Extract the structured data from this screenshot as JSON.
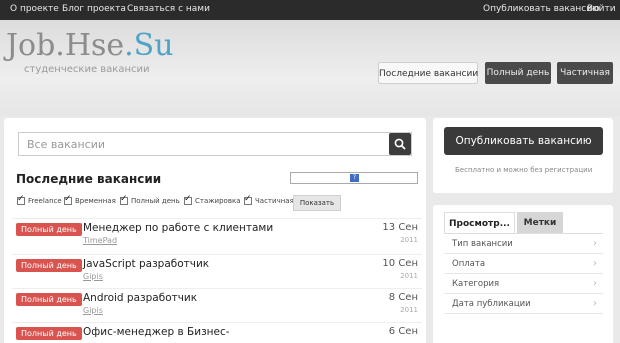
{
  "topnav": {
    "about": "О проекте",
    "blog": "Блог проекта",
    "contact": "Связаться с нами",
    "publish": "Опубликовать вакансию",
    "login": "Войти"
  },
  "header": {
    "logo_main": "Job.Hse",
    "logo_suffix": ".Su",
    "slogan": "студенческие вакансии",
    "buttons": [
      "Последние вакансии",
      "Полный день",
      "Частичная"
    ]
  },
  "search": {
    "placeholder": "Все вакансии"
  },
  "latest": {
    "title": "Последние вакансии",
    "filter_hint": "?",
    "filters": [
      "Freelance",
      "Временная",
      "Полный день",
      "Стажировка",
      "Частичная"
    ],
    "show_button": "Показать"
  },
  "jobs": [
    {
      "badge": "Полный день",
      "title": "Менеджер по работе с клиентами",
      "company": "TimePad",
      "date": "13 Сен",
      "year": "2011"
    },
    {
      "badge": "Полный день",
      "title": "JavaScript разработчик",
      "company": "Gipis",
      "date": "10 Сен",
      "year": "2011"
    },
    {
      "badge": "Полный день",
      "title": "Android разработчик",
      "company": "Gipis",
      "date": "8 Сен",
      "year": "2011"
    },
    {
      "badge": "Полный день",
      "title": "Офис-менеджер в Бизнес-",
      "company": "",
      "date": "6 Сен",
      "year": ""
    }
  ],
  "sidebar": {
    "publish_button": "Опубликовать вакансию",
    "publish_note": "Бесплатно и можно без регистрации",
    "tabs": [
      "Просмотр...",
      "Метки"
    ],
    "menu": [
      "Тип вакансии",
      "Оплата",
      "Категория",
      "Дата публикации"
    ]
  },
  "colors": {
    "badge": "#d9534f",
    "dark_button": "#3a3a3a",
    "logo_accent": "#4fa3c7"
  }
}
